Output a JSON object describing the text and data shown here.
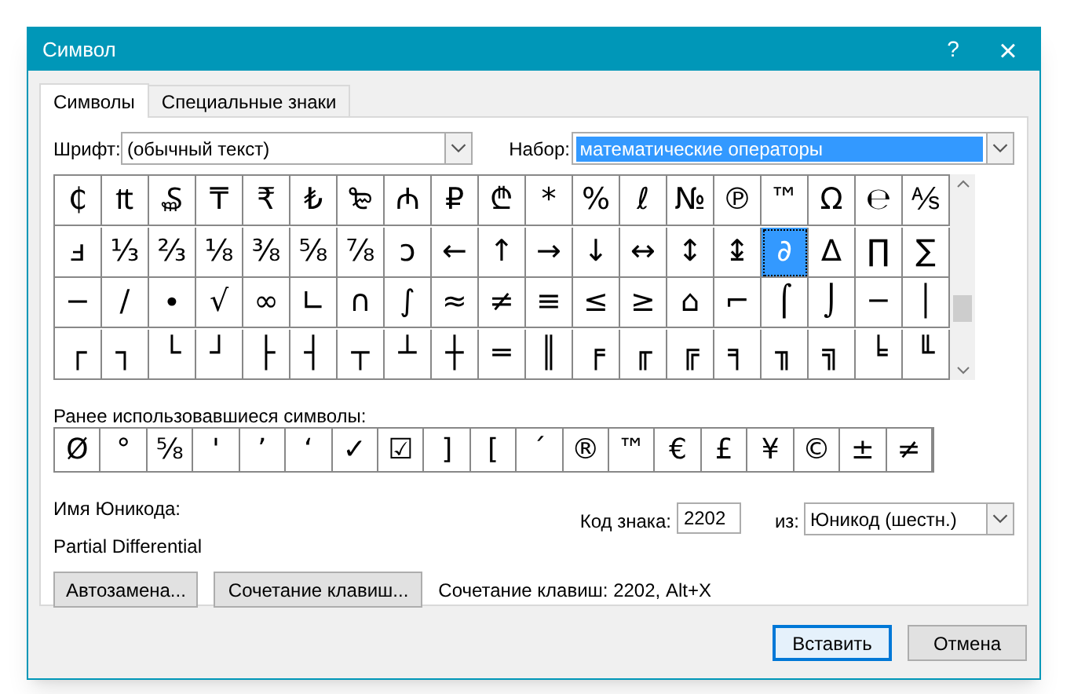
{
  "window": {
    "title": "Символ",
    "help": "?",
    "close": "×"
  },
  "tabs": [
    {
      "label": "Символы",
      "selected": true
    },
    {
      "label": "Специальные знаки",
      "selected": false
    }
  ],
  "font": {
    "label": "Шрифт:",
    "value": "(обычный текст)"
  },
  "subset": {
    "label": "Набор:",
    "value": "математические операторы"
  },
  "symbol_grid": {
    "rows": [
      [
        {
          "char": "₵",
          "selected": false
        },
        {
          "char": "₶",
          "selected": false
        },
        {
          "char": "₷",
          "selected": false
        },
        {
          "char": "₸",
          "selected": false
        },
        {
          "char": "₹",
          "selected": false
        },
        {
          "char": "₺",
          "selected": false
        },
        {
          "char": "₻",
          "selected": false
        },
        {
          "char": "₼",
          "selected": false
        },
        {
          "char": "₽",
          "selected": false
        },
        {
          "char": "₾",
          "selected": false
        },
        {
          "char": "*",
          "selected": false
        },
        {
          "char": "%",
          "selected": false
        },
        {
          "char": "ℓ",
          "selected": false
        },
        {
          "char": "№",
          "selected": false
        },
        {
          "char": "℗",
          "selected": false
        },
        {
          "char": "™",
          "selected": false
        },
        {
          "char": "Ω",
          "selected": false
        },
        {
          "char": "℮",
          "selected": false
        },
        {
          "char": "⅍",
          "selected": false
        }
      ],
      [
        {
          "char": "ⅎ",
          "selected": false
        },
        {
          "char": "⅓",
          "selected": false
        },
        {
          "char": "⅔",
          "selected": false
        },
        {
          "char": "⅛",
          "selected": false
        },
        {
          "char": "⅜",
          "selected": false
        },
        {
          "char": "⅝",
          "selected": false
        },
        {
          "char": "⅞",
          "selected": false
        },
        {
          "char": "ↄ",
          "selected": false
        },
        {
          "char": "←",
          "selected": false
        },
        {
          "char": "↑",
          "selected": false
        },
        {
          "char": "→",
          "selected": false
        },
        {
          "char": "↓",
          "selected": false
        },
        {
          "char": "↔",
          "selected": false
        },
        {
          "char": "↕",
          "selected": false
        },
        {
          "char": "↨",
          "selected": false
        },
        {
          "char": "∂",
          "selected": true
        },
        {
          "char": "∆",
          "selected": false
        },
        {
          "char": "∏",
          "selected": false
        },
        {
          "char": "∑",
          "selected": false
        }
      ],
      [
        {
          "char": "−",
          "selected": false
        },
        {
          "char": "∕",
          "selected": false
        },
        {
          "char": "∙",
          "selected": false
        },
        {
          "char": "√",
          "selected": false
        },
        {
          "char": "∞",
          "selected": false
        },
        {
          "char": "∟",
          "selected": false
        },
        {
          "char": "∩",
          "selected": false
        },
        {
          "char": "∫",
          "selected": false
        },
        {
          "char": "≈",
          "selected": false
        },
        {
          "char": "≠",
          "selected": false
        },
        {
          "char": "≡",
          "selected": false
        },
        {
          "char": "≤",
          "selected": false
        },
        {
          "char": "≥",
          "selected": false
        },
        {
          "char": "⌂",
          "selected": false
        },
        {
          "char": "⌐",
          "selected": false
        },
        {
          "char": "⌠",
          "selected": false
        },
        {
          "char": "⌡",
          "selected": false
        },
        {
          "char": "─",
          "selected": false
        },
        {
          "char": "│",
          "selected": false
        }
      ],
      [
        {
          "char": "┌",
          "selected": false
        },
        {
          "char": "┐",
          "selected": false
        },
        {
          "char": "└",
          "selected": false
        },
        {
          "char": "┘",
          "selected": false
        },
        {
          "char": "├",
          "selected": false
        },
        {
          "char": "┤",
          "selected": false
        },
        {
          "char": "┬",
          "selected": false
        },
        {
          "char": "┴",
          "selected": false
        },
        {
          "char": "┼",
          "selected": false
        },
        {
          "char": "═",
          "selected": false
        },
        {
          "char": "║",
          "selected": false
        },
        {
          "char": "╒",
          "selected": false
        },
        {
          "char": "╓",
          "selected": false
        },
        {
          "char": "╔",
          "selected": false
        },
        {
          "char": "╕",
          "selected": false
        },
        {
          "char": "╖",
          "selected": false
        },
        {
          "char": "╗",
          "selected": false
        },
        {
          "char": "╘",
          "selected": false
        },
        {
          "char": "╙",
          "selected": false
        }
      ]
    ]
  },
  "recent": {
    "label": "Ранее использовавшиеся символы:",
    "symbols": [
      "Ø",
      "°",
      "⅝",
      "'",
      "’",
      "‘",
      "✓",
      "☑",
      "]",
      "[",
      "´",
      "®",
      "™",
      "€",
      "£",
      "¥",
      "©",
      "±",
      "≠"
    ]
  },
  "unicode_name": {
    "label": "Имя Юникода:",
    "value": "Partial Differential"
  },
  "char_code": {
    "label": "Код знака:",
    "value": "2202"
  },
  "from": {
    "label": "из:",
    "value": "Юникод (шестн.)"
  },
  "buttons": [
    "Автозамена...",
    "Сочетание клавиш..."
  ],
  "shortcut_text": "Сочетание клавиш: 2202, Alt+X",
  "footer_buttons": [
    {
      "label": "Вставить",
      "default": true
    },
    {
      "label": "Отмена",
      "default": false
    }
  ]
}
